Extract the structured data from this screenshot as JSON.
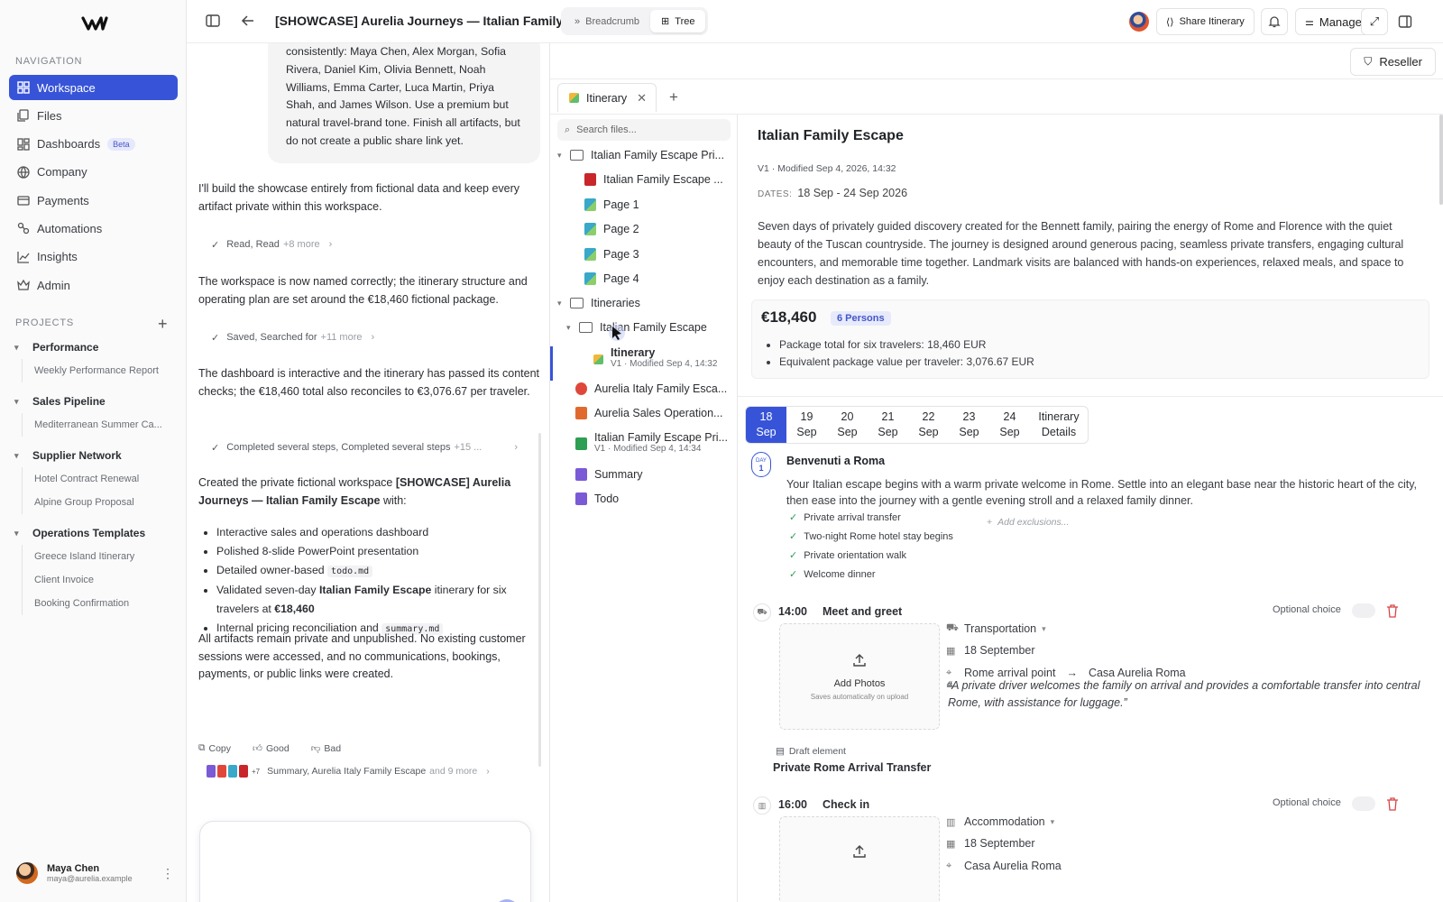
{
  "sidebar": {
    "nav_label": "NAVIGATION",
    "nav": [
      {
        "label": "Workspace",
        "icon": "grid-icon"
      },
      {
        "label": "Files",
        "icon": "files-icon"
      },
      {
        "label": "Dashboards",
        "icon": "dashboard-icon",
        "badge": "Beta"
      },
      {
        "label": "Company",
        "icon": "company-icon"
      },
      {
        "label": "Payments",
        "icon": "card-icon"
      },
      {
        "label": "Automations",
        "icon": "automation-icon"
      },
      {
        "label": "Insights",
        "icon": "chart-icon"
      },
      {
        "label": "Admin",
        "icon": "crown-icon"
      }
    ],
    "projects_label": "PROJECTS",
    "projects": [
      {
        "name": "Performance",
        "items": [
          "Weekly Performance Report"
        ]
      },
      {
        "name": "Sales Pipeline",
        "items": [
          "Mediterranean Summer Ca..."
        ]
      },
      {
        "name": "Supplier Network",
        "items": [
          "Hotel Contract Renewal",
          "Alpine Group Proposal"
        ]
      },
      {
        "name": "Operations Templates",
        "items": [
          "Greece Island Itinerary",
          "Client Invoice",
          "Booking Confirmation"
        ]
      }
    ],
    "user": {
      "name": "Maya Chen",
      "email": "maya@aurelia.example"
    }
  },
  "topbar": {
    "title": "[SHOWCASE] Aurelia Journeys — Italian Family Es...",
    "breadcrumb": "Breadcrumb",
    "tree": "Tree",
    "share": "Share Itinerary",
    "manage": "Manage"
  },
  "chat": {
    "bubble": "consistently: Maya Chen, Alex Morgan, Sofia Rivera, Daniel Kim, Olivia Bennett, Noah Williams, Emma Carter, Luca Martin, Priya Shah, and James Wilson. Use a premium but natural travel-brand tone. Finish all artifacts, but do not create a public share link yet.",
    "p1": "I'll build the showcase entirely from fictional data and keep every artifact private within this workspace.",
    "s1": "Read, Read",
    "s1_more": "+8 more",
    "p2": "The workspace is now named correctly; the itinerary structure and operating plan are set around the €18,460 fictional package.",
    "s2": "Saved, Searched for",
    "s2_more": "+11 more",
    "p3": "The dashboard is interactive and the itinerary has passed its content checks; the €18,460 total also reconciles to €3,076.67 per traveler.",
    "s3": "Completed several steps, Completed several steps",
    "s3_more": "+15 ...",
    "p4a": "Created the private fictional workspace ",
    "p4b": "[SHOWCASE] Aurelia Journeys — Italian Family Escape",
    "p4c": " with:",
    "b1": "Interactive sales and operations dashboard",
    "b2": "Polished 8-slide PowerPoint presentation",
    "b3": "Detailed owner-based ",
    "b3code": "todo.md",
    "b4a": "Validated seven-day ",
    "b4b": "Italian Family Escape",
    "b4c": " itinerary for six travelers at ",
    "b4d": "€18,460",
    "b5": "Internal pricing reconciliation and ",
    "b5code": "summary.md",
    "p5": "All artifacts remain private and unpublished. No existing customer sessions were accessed, and no communications, bookings, payments, or public links were created.",
    "copy": "Copy",
    "good": "Good",
    "bad": "Bad",
    "src_count": "+7",
    "src_text": "Summary, Aurelia Italy Family Escape",
    "src_more": "and 9 more"
  },
  "right": {
    "reseller": "Reseller",
    "tab": "Itinerary",
    "search_placeholder": "Search files..."
  },
  "tree": [
    {
      "label": "Italian Family Escape Pri...",
      "kind": "folder"
    },
    {
      "label": "Italian Family Escape ...",
      "kind": "pdf"
    },
    {
      "label": "Page 1",
      "kind": "img"
    },
    {
      "label": "Page 2",
      "kind": "img"
    },
    {
      "label": "Page 3",
      "kind": "img"
    },
    {
      "label": "Page 4",
      "kind": "img"
    },
    {
      "label": "Itineraries",
      "kind": "folder"
    },
    {
      "label": "Italian Family Escape",
      "kind": "folder"
    },
    {
      "label": "Itinerary",
      "kind": "itin",
      "meta": "V1 · Modified Sep 4, 14:32"
    },
    {
      "label": "Aurelia Italy Family Esca...",
      "kind": "dash"
    },
    {
      "label": "Aurelia Sales Operation...",
      "kind": "ppt"
    },
    {
      "label": "Italian Family Escape Pri...",
      "kind": "xls",
      "meta": "V1 · Modified Sep 4, 14:34"
    },
    {
      "label": "Summary",
      "kind": "doc"
    },
    {
      "label": "Todo",
      "kind": "doc"
    }
  ],
  "doc": {
    "title": "Italian Family Escape",
    "meta": "V1 · Modified Sep 4, 2026, 14:32",
    "dates_label": "DATES:",
    "dates": "18 Sep - 24 Sep 2026",
    "desc": "Seven days of privately guided discovery created for the Bennett family, pairing the energy of Rome and Florence with the quiet beauty of the Tuscan countryside. The journey is designed around generous pacing, seamless private transfers, engaging cultural encounters, and memorable time together. Landmark visits are balanced with hands-on experiences, relaxed meals, and space to enjoy each destination as a family.",
    "price": "€18,460",
    "persons": "6 Persons",
    "price_lines": [
      "Package total for six travelers: 18,460 EUR",
      "Equivalent package value per traveler: 3,076.67 EUR"
    ],
    "days": [
      {
        "d": "18",
        "m": "Sep"
      },
      {
        "d": "19",
        "m": "Sep"
      },
      {
        "d": "20",
        "m": "Sep"
      },
      {
        "d": "21",
        "m": "Sep"
      },
      {
        "d": "22",
        "m": "Sep"
      },
      {
        "d": "23",
        "m": "Sep"
      },
      {
        "d": "24",
        "m": "Sep"
      }
    ],
    "days_extra": [
      "Itinerary",
      "Details"
    ],
    "day_badge": {
      "word": "DAY",
      "num": "1"
    },
    "day_title": "Benvenuti a Roma",
    "day_text": "Your Italian escape begins with a warm private welcome in Rome. Settle into an elegant base near the historic heart of the city, then ease into the journey with a gentle evening stroll and a relaxed family dinner.",
    "inclusions": [
      "Private arrival transfer",
      "Two-night Rome hotel stay begins",
      "Private orientation walk",
      "Welcome dinner"
    ],
    "add_exclusions": "Add exclusions...",
    "ev1": {
      "time": "14:00",
      "title": "Meet and greet",
      "optional": "Optional choice",
      "type": "Transportation",
      "date": "18 September",
      "from": "Rome arrival point",
      "to": "Casa Aurelia Roma",
      "quote": "“A private driver welcomes the family on arrival and provides a comfortable transfer into central Rome, with assistance for luggage.”",
      "add_photos": "Add Photos",
      "saves": "Saves automatically on upload",
      "draft": "Draft element",
      "name": "Private Rome Arrival Transfer"
    },
    "ev2": {
      "time": "16:00",
      "title": "Check in",
      "optional": "Optional choice",
      "type": "Accommodation",
      "date": "18 September",
      "place": "Casa Aurelia Roma"
    }
  }
}
